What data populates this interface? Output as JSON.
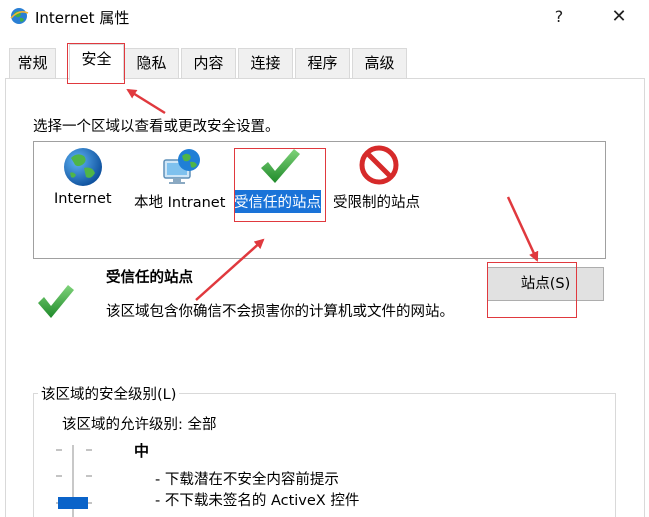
{
  "window": {
    "title": "Internet 属性",
    "help": "?",
    "close": "✕"
  },
  "tabs": [
    {
      "label": "常规",
      "active": false
    },
    {
      "label": "安全",
      "active": true
    },
    {
      "label": "隐私",
      "active": false
    },
    {
      "label": "内容",
      "active": false
    },
    {
      "label": "连接",
      "active": false
    },
    {
      "label": "程序",
      "active": false
    },
    {
      "label": "高级",
      "active": false
    }
  ],
  "security": {
    "instruction": "选择一个区域以查看或更改安全设置。",
    "zones": [
      {
        "label": "Internet",
        "icon": "globe-icon",
        "selected": false
      },
      {
        "label": "本地 Intranet",
        "icon": "intranet-icon",
        "selected": false
      },
      {
        "label": "受信任的站点",
        "icon": "checkmark-icon",
        "selected": true
      },
      {
        "label": "受限制的站点",
        "icon": "restricted-icon",
        "selected": false
      }
    ],
    "selected_zone": {
      "title": "受信任的站点",
      "description": "该区域包含你确信不会损害你的计算机或文件的网站。"
    },
    "sites_button": "站点(S)",
    "level_group_label": "该区域的安全级别(L)",
    "allowed_level": "该区域的允许级别: 全部",
    "level_name": "中",
    "level_details": [
      "- 下载潜在不安全内容前提示",
      "- 不下载未签名的 ActiveX 控件"
    ]
  },
  "colors": {
    "selection": "#1a73d8",
    "annotation": "#e0393e",
    "slider_thumb": "#0a63c9",
    "check_green": "#3aa83a"
  }
}
